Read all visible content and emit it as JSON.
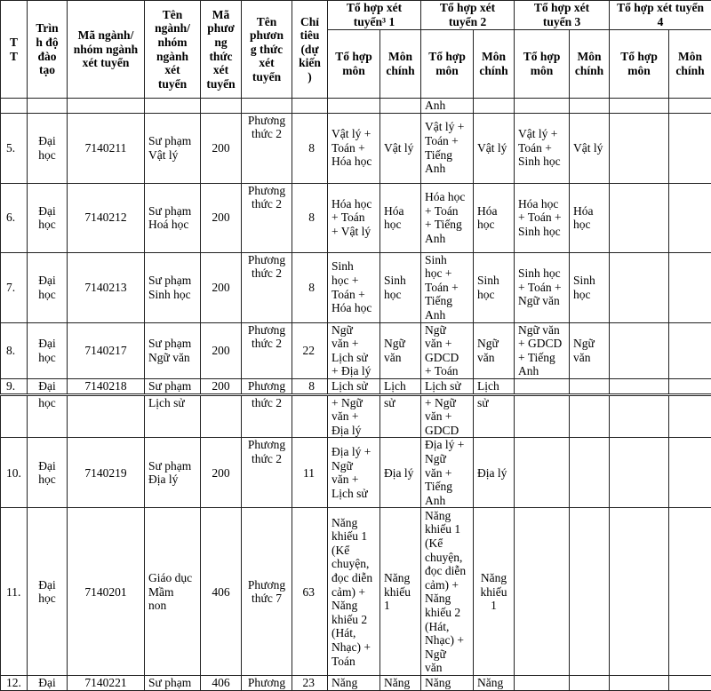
{
  "header": {
    "columns": [
      "T\nT",
      "Trìn\nh độ\nđào\ntạo",
      "Mã ngành/\nnhóm ngành\nxét tuyển",
      "Tên\nngành/\nnhóm\nngành\nxét\ntuyển",
      "Mã\nphươ\nng\nthức\nxét\ntuyển",
      "Tên\nphươn\ng thức\nxét\ntuyển",
      "Chỉ\ntiêu\n(dự\nkiến\n)"
    ],
    "groups": [
      "Tổ hợp xét\ntuyển³ 1",
      "Tổ hợp xét\ntuyển 2",
      "Tổ hợp xét\ntuyển 3",
      "Tổ hợp xét tuyển\n4"
    ],
    "sub_mon": "Tổ hợp\nmôn",
    "sub_chinh": "Môn\nchính"
  },
  "rows": [
    [
      "",
      "",
      "",
      "",
      "",
      "",
      "",
      "",
      "",
      "Anh",
      "",
      "",
      "",
      "",
      ""
    ],
    [
      "5.",
      "Đại\nhọc",
      "7140211",
      "Sư phạm\nVật lý",
      "200",
      "Phương\nthức 2",
      "8",
      "Vật lý +\nToán +\nHóa học",
      "Vật lý",
      "Vật lý +\nToán +\nTiếng\nAnh",
      "Vật lý",
      "Vật lý +\nToán +\nSinh học",
      "Vật lý",
      "",
      ""
    ],
    [
      "6.",
      "Đại\nhọc",
      "7140212",
      "Sư phạm\nHoá học",
      "200",
      "Phương\nthức 2",
      "8",
      "Hóa học\n+ Toán\n+ Vật lý",
      "Hóa\nhọc",
      "Hóa học\n+ Toán\n+ Tiếng\nAnh",
      "Hóa\nhọc",
      "Hóa học\n+ Toán +\nSinh học",
      "Hóa\nhọc",
      "",
      ""
    ],
    [
      "7.",
      "Đại\nhọc",
      "7140213",
      "Sư phạm\nSinh học",
      "200",
      "Phương\nthức 2",
      "8",
      "Sinh\nhọc +\nToán +\nHóa học",
      "Sinh\nhọc",
      "Sinh\nhọc +\nToán +\nTiếng\nAnh",
      "Sinh\nhọc",
      "Sinh học\n+ Toán +\nNgữ văn",
      "Sinh\nhọc",
      "",
      ""
    ],
    [
      "8.",
      "Đại\nhọc",
      "7140217",
      "Sư phạm\nNgữ văn",
      "200",
      "Phương\nthức 2",
      "22",
      "Ngữ\nvăn +\nLịch sử\n+ Địa lý",
      "Ngữ\nvăn",
      "Ngữ\nvăn +\nGDCD\n+ Toán",
      "Ngữ\nvăn",
      "Ngữ văn\n+ GDCD\n+ Tiếng\nAnh",
      "Ngữ\nvăn",
      "",
      ""
    ],
    [
      "9.",
      "Đại",
      "7140218",
      "Sư phạm",
      "200",
      "Phương",
      "8",
      "Lịch sử",
      "Lịch",
      "Lịch sử",
      "Lịch",
      "",
      "",
      "",
      ""
    ],
    [
      "",
      "học",
      "",
      "Lịch sử",
      "",
      "thức 2",
      "",
      "+ Ngữ\nvăn +\nĐịa lý",
      "sử",
      "+ Ngữ\nvăn +\nGDCD",
      "sử",
      "",
      "",
      "",
      ""
    ],
    [
      "10.",
      "Đại\nhọc",
      "7140219",
      "Sư phạm\nĐịa lý",
      "200",
      "Phương\nthức 2",
      "11",
      "Địa lý +\nNgữ\nvăn +\nLịch sử",
      "Địa lý",
      "Địa lý +\nNgữ\nvăn +\nTiếng\nAnh",
      "Địa lý",
      "",
      "",
      "",
      ""
    ],
    [
      "11.",
      "Đại\nhọc",
      "7140201",
      "Giáo dục\nMầm\nnon",
      "406",
      "Phương\nthức 7",
      "63",
      "Năng\nkhiếu 1\n(Kể\nchuyện,\nđọc diễn\ncảm) +\nNăng\nkhiếu 2\n(Hát,\nNhạc) +\nToán",
      "Năng\nkhiếu\n1",
      "Năng\nkhiếu 1\n(Kể\nchuyện,\nđọc diễn\ncảm) +\nNăng\nkhiếu 2\n(Hát,\nNhạc) +\nNgữ\nvăn",
      "Năng\nkhiếu\n1",
      "",
      "",
      "",
      ""
    ],
    [
      "12.",
      "Đại",
      "7140221",
      "Sư phạm",
      "406",
      "Phương",
      "23",
      "Năng",
      "Năng",
      "Năng",
      "Năng",
      "",
      "",
      "",
      ""
    ]
  ]
}
